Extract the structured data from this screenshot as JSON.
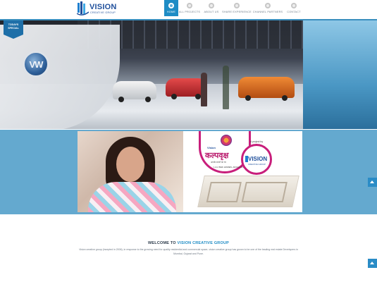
{
  "header": {
    "logo_text": "VISION",
    "logo_sub": "CREATIVE GROUP",
    "nav": [
      {
        "label": "HOME",
        "icon": "home-icon",
        "active": true
      },
      {
        "label": "ALL PROJECTS",
        "icon": "projects-icon",
        "active": false
      },
      {
        "label": "ABOUT US",
        "icon": "about-icon",
        "active": false
      },
      {
        "label": "SHARE EXPERIENCE",
        "icon": "share-icon",
        "active": false
      },
      {
        "label": "CHANNEL PARTNERS",
        "icon": "partners-icon",
        "active": false
      },
      {
        "label": "CONTACT",
        "icon": "phone-icon",
        "active": false
      }
    ]
  },
  "hero": {
    "badge_line1": "TODAYS",
    "badge_line2": "SPECIAL"
  },
  "promo": {
    "brand": "Vision",
    "project_name": "कल्पवृक्ष",
    "tagline": "आपके सपनों का घर",
    "bhk": "1 & 2 BHK HOMES, AKOLE ROAD",
    "project_by": "A project by",
    "vision_name": "VISION",
    "vision_sub": "CREATIVE GROUP"
  },
  "welcome": {
    "title_prefix": "WELCOME TO ",
    "title_accent": "VISION CREATIVE GROUP",
    "description": "Vision creative group (incepted in 2006), in response to the growing need for quality residential and commercial space, vision creative group has grown to be one of the leading real estate Developers in Mumbai, Gujarat and Pune."
  },
  "colors": {
    "accent": "#1e8cc5",
    "band": "#64a9cf",
    "brand_pink": "#c81e7b"
  }
}
